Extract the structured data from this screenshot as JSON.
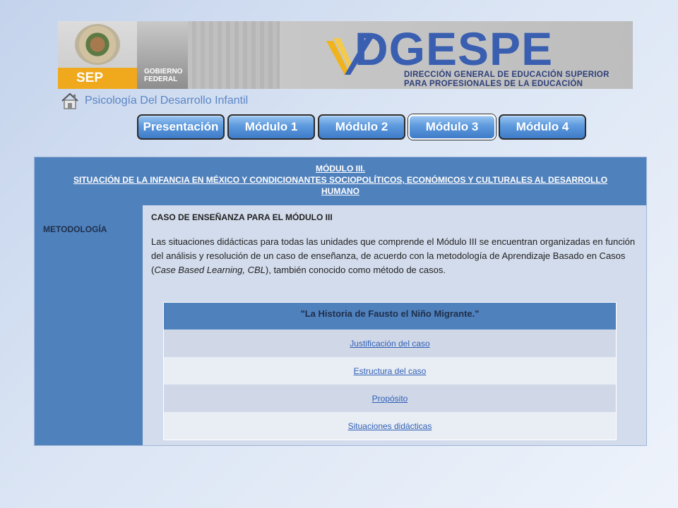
{
  "banner": {
    "sep_label": "SEP",
    "gobierno_label": "GOBIERNO FEDERAL",
    "logo_title": "DGESPE",
    "logo_subtitle_line1": "DIRECCIÓN GENERAL DE EDUCACIÓN SUPERIOR",
    "logo_subtitle_line2": "PARA PROFESIONALES DE LA EDUCACIÓN"
  },
  "site_title": "Psicología Del Desarrollo Infantil",
  "nav": {
    "items": [
      {
        "label": "Presentación"
      },
      {
        "label": "Módulo 1"
      },
      {
        "label": "Módulo 2"
      },
      {
        "label": "Módulo 3",
        "active": true
      },
      {
        "label": "Módulo 4"
      }
    ]
  },
  "module_header": {
    "line1": "MÓDULO III.",
    "line2": "SITUACIÓN DE LA INFANCIA EN MÉXICO Y CONDICIONANTES SOCIOPOLÍTICOS, ECONÓMICOS Y CULTURALES AL DESARROLLO",
    "line3": "HUMANO"
  },
  "left_label": "METODOLOGÍA",
  "case_title": "CASO DE ENSEÑANZA PARA EL MÓDULO III",
  "paragraph": {
    "part1": "Las situaciones didácticas para todas las unidades que comprende el Módulo III se encuentran organizadas en función del análisis y resolución de un caso de enseñanza, de acuerdo con la metodología de Aprendizaje Basado en Casos (",
    "italic": "Case Based Learning, CBL",
    "part2": "), también conocido como método de casos."
  },
  "case_table": {
    "header": "\"La Historia de Fausto el Niño Migrante.\"",
    "links": [
      "Justificación del caso",
      "Estructura del caso",
      "Propósito",
      "Situaciones didácticas"
    ]
  },
  "colors": {
    "header_blue": "#4f81bd",
    "link_blue": "#2f5fb6",
    "title_blue": "#5a86c6"
  }
}
